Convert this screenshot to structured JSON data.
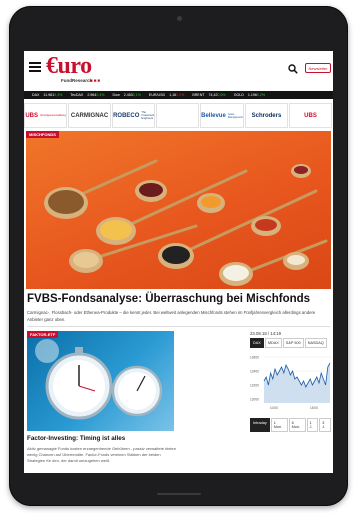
{
  "header": {
    "logo_text": "€uro",
    "logo_sub": "FundResearch",
    "logo_dots": "■■■",
    "search_icon": "search-icon",
    "newsletter_label": "Newsletter",
    "brand_color": "#c8102e"
  },
  "ticker": [
    {
      "name": "DAX",
      "value": "11.981",
      "change": "0,4%",
      "dir": "up"
    },
    {
      "name": "TecDAX",
      "value": "2.964",
      "change": "0,4%",
      "dir": "up"
    },
    {
      "name": "Dow",
      "value": "2.453",
      "change": "0,1%",
      "dir": "up"
    },
    {
      "name": "EUR/USD",
      "value": "1,16",
      "change": "0,2%",
      "dir": "down"
    },
    {
      "name": "BRENT",
      "value": "74,42",
      "change": "0,5%",
      "dir": "up"
    },
    {
      "name": "GOLD",
      "value": "1.196",
      "change": "0,2%",
      "dir": "up"
    }
  ],
  "ads": [
    {
      "label": "UBS",
      "sub": "Vermögensverwaltung",
      "color": "#c8102e"
    },
    {
      "label": "CARMIGNAC",
      "color": "#333333"
    },
    {
      "label": "ROBECO",
      "sub": "The Investment Engineers",
      "color": "#1d3e6e"
    },
    {
      "label": "",
      "color": "#555555"
    },
    {
      "label": "Bellevue",
      "sub": "Asset Management",
      "color": "#1b5aa8"
    },
    {
      "label": "Schroders",
      "color": "#0a2a5a"
    },
    {
      "label": "UBS",
      "color": "#c8102e"
    }
  ],
  "hero": {
    "tag": "MISCHFONDS",
    "title": "FVBS-Fondsanalyse: Überraschung bei Mischfonds",
    "teaser": "Carmignac-, Flossbach- oder Ethenea-Produkte – die kennt jeder. Bei weltweit anlegenden Mischfonds stehen im Fünfjahresvergleich allerdings andere Anbieter ganz oben."
  },
  "card": {
    "tag": "FAKTOR-ETF",
    "title": "Factor-Investing: Timing ist alles",
    "teaser": "Aktiv gemanagte Fonds kosten erzaegenhende Gebühren - passiv verwaltete bieten wenig Chancen auf Überrendite. Factor-Fonds vereinen Stärken der beiden Strategien für den, der damit umzugehen weiß."
  },
  "widget": {
    "date": "23.08.18 / 14:19",
    "tabs": [
      "DAX",
      "MDAX",
      "S&P 500",
      "NASDAQ"
    ],
    "active_tab": 0,
    "ranges": [
      "Intraday",
      "1 Mon.",
      "6 Mon.",
      "1 J.",
      "3 J."
    ],
    "active_range": 0,
    "y_labels": [
      "12600",
      "12400",
      "12200",
      "12000"
    ],
    "x_labels": [
      "10:00",
      "15:00"
    ],
    "series_color": "#1b5aa8"
  }
}
